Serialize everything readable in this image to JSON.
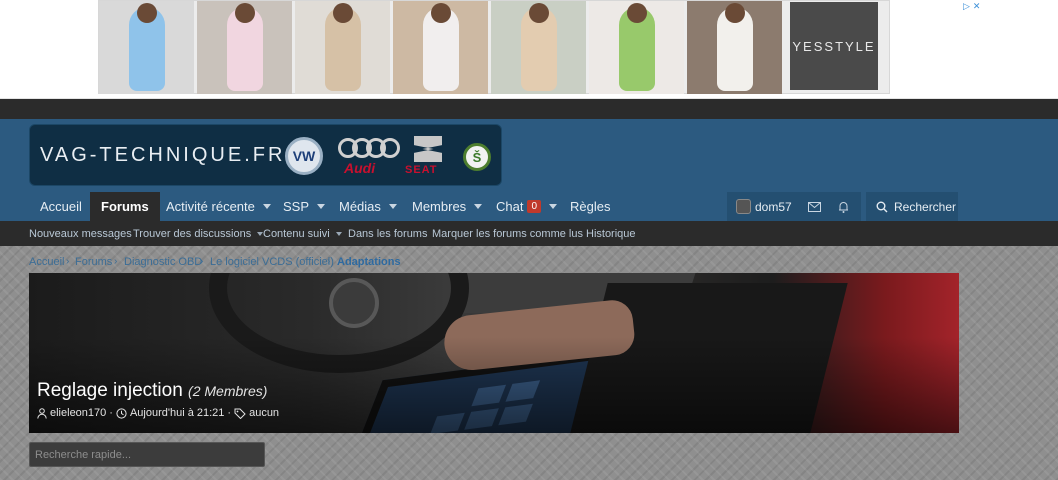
{
  "ad": {
    "brand": "YESSTYLE",
    "controls": [
      "▷",
      "✕"
    ],
    "photos": [
      {
        "bg": "#d9d9d9",
        "outfit": "#8fc3ea"
      },
      {
        "bg": "#c9c2bb",
        "outfit": "#f1d6e0"
      },
      {
        "bg": "#e0dcd6",
        "outfit": "#d6c1a6"
      },
      {
        "bg": "#cdb9a3",
        "outfit": "#f1eeee"
      },
      {
        "bg": "#c9cfc4",
        "outfit": "#e3ccb0"
      },
      {
        "bg": "#ede9e6",
        "outfit": "#98c96b"
      },
      {
        "bg": "#8c7b6e",
        "outfit": "#f2f0ec"
      }
    ]
  },
  "header": {
    "logo_text": "VAG-TECHNIQUE.FR",
    "brands": {
      "vw": "VW",
      "audi": "Audi",
      "seat": "SEAT",
      "skoda": "Š"
    }
  },
  "nav": {
    "items": [
      {
        "label": "Accueil"
      },
      {
        "label": "Forums"
      },
      {
        "label": "Activité récente"
      },
      {
        "label": "SSP"
      },
      {
        "label": "Médias"
      },
      {
        "label": "Membres"
      },
      {
        "label": "Chat"
      },
      {
        "label": "Règles"
      }
    ],
    "chat_badge": "0",
    "user": "dom57",
    "search_label": "Rechercher"
  },
  "subnav": {
    "items": [
      {
        "label": "Nouveaux messages"
      },
      {
        "label": "Trouver des discussions"
      },
      {
        "label": "Contenu suivi"
      },
      {
        "label": "Dans les forums"
      },
      {
        "label": "Marquer les forums comme lus"
      },
      {
        "label": "Historique"
      }
    ]
  },
  "breadcrumb": [
    "Accueil",
    "Forums",
    "Diagnostic OBD",
    "Le logiciel VCDS (officiel)",
    "Adaptations"
  ],
  "thread": {
    "title": "Reglage injection",
    "members": "(2 Membres)",
    "author": "elieleon170",
    "date": "Aujourd'hui à 21:21",
    "tags": "aucun"
  },
  "quick_search": {
    "placeholder": "Recherche rapide..."
  }
}
